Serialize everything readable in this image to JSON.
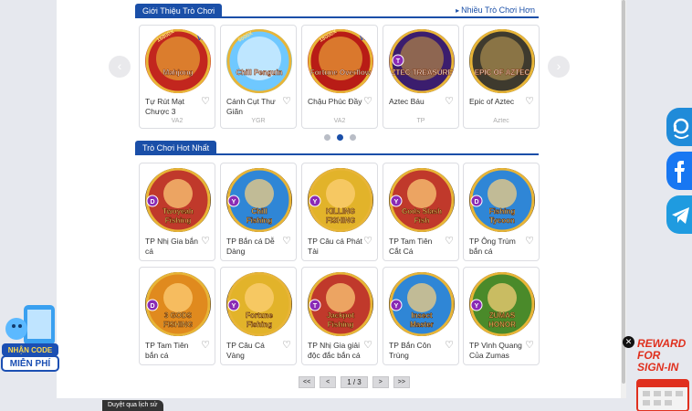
{
  "featured": {
    "title": "Giới Thiệu Trò Chơi",
    "more_link": "Nhiều Trò Chơi Hơn",
    "games": [
      {
        "name": "Tự Rút Mạt Chược 3",
        "provider": "VA2",
        "badge": "VA",
        "art": "mahjong",
        "art_text": "Mahjong",
        "ribbon": "16800X"
      },
      {
        "name": "Cánh Cụt Thư Giãn",
        "provider": "YGR",
        "badge": "",
        "art": "penguin",
        "art_text": "Chill Penguin",
        "ribbon": "6000X"
      },
      {
        "name": "Chậu Phúc Đầy",
        "provider": "VA2",
        "badge": "VA",
        "art": "fortune",
        "art_text": "Fortune Overflow",
        "ribbon": "18000X"
      },
      {
        "name": "Aztec Báu",
        "provider": "TP",
        "badge": "T",
        "art": "aztec",
        "art_text": "AZTEC TREASURES",
        "ribbon": ""
      },
      {
        "name": "Epic of Aztec",
        "provider": "Aztec",
        "badge": "",
        "art": "epic",
        "art_text": "EPIC OF AZTEC",
        "ribbon": ""
      }
    ]
  },
  "hot": {
    "title": "Trò Chơi Hot Nhất",
    "games": [
      {
        "name": "TP Nhị Gia bắn cá",
        "art_text": "Twoyeah Fishing",
        "badge": "D",
        "color": "#c0392b"
      },
      {
        "name": "TP Bắn cá Dễ Dàng",
        "art_text": "Chill Fishing",
        "badge": "Y",
        "color": "#2f86d6"
      },
      {
        "name": "TP Câu cá Phát Tài",
        "art_text": "KILLING FISHING",
        "badge": "Y",
        "color": "#e2b32a"
      },
      {
        "name": "TP Tam Tiên Cắt Cá",
        "art_text": "Gods Slash Fish",
        "badge": "Y",
        "color": "#c0392b"
      },
      {
        "name": "TP Ông Trùm bắn cá",
        "art_text": "Fishing Tycoon",
        "badge": "D",
        "color": "#2f86d6"
      },
      {
        "name": "TP Tam Tiên bắn cá",
        "art_text": "3 GODS FISHING",
        "badge": "D",
        "color": "#e08a1e"
      },
      {
        "name": "TP Câu Cá Vàng",
        "art_text": "Fortune Fishing",
        "badge": "Y",
        "color": "#e2b32a"
      },
      {
        "name": "TP Nhị Gia giải độc đắc bắn cá",
        "art_text": "Jackpot Fishing",
        "badge": "T",
        "color": "#c0392b"
      },
      {
        "name": "TP Bắn Côn Trùng",
        "art_text": "Insect Master",
        "badge": "Y",
        "color": "#2f86d6"
      },
      {
        "name": "TP Vinh Quang Của Zumas",
        "art_text": "ZUMAS HONOR",
        "badge": "Y",
        "color": "#4a8a2a"
      }
    ]
  },
  "pagination": {
    "first": "<<",
    "prev": "<",
    "info": "1 / 3",
    "next": ">",
    "last": ">>"
  },
  "promo_left": {
    "line1": "NHẬN CODE",
    "line2": "MIỄN PHÍ"
  },
  "promo_right": {
    "line1": "REWARD",
    "line2": "FOR",
    "line3": "SIGN-IN"
  },
  "history_bar": "Duyệt qua lịch sử",
  "colors": {
    "accent": "#1a4fa8",
    "background": "#e6e8ee"
  }
}
